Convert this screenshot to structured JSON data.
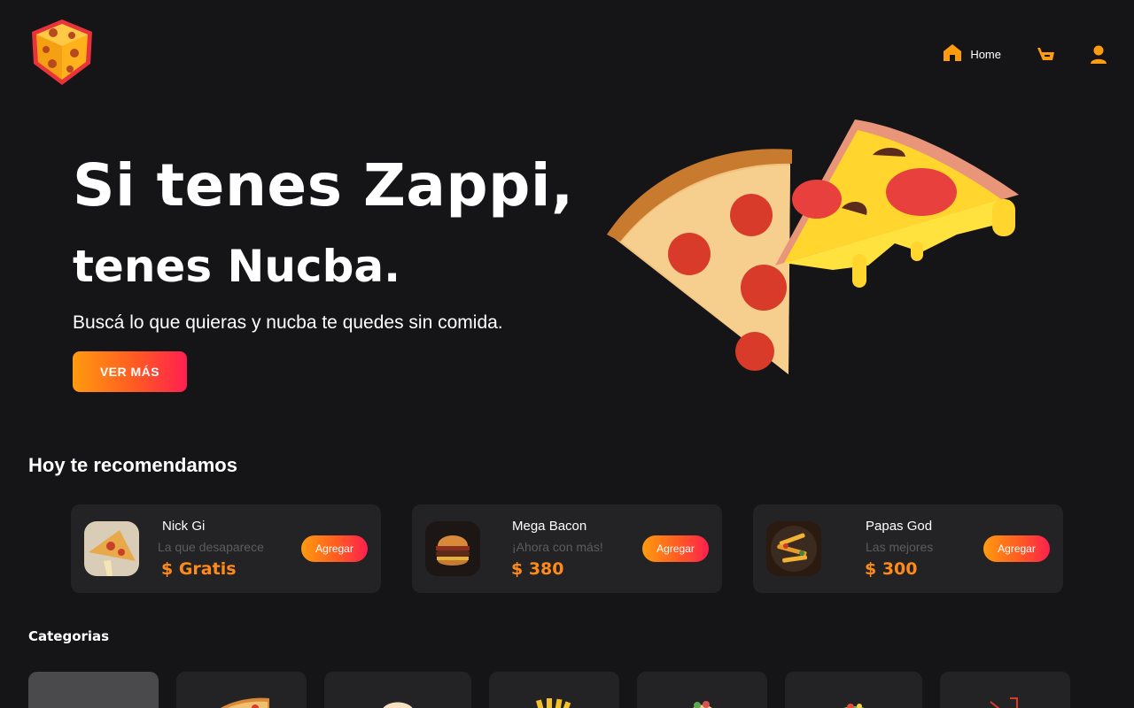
{
  "header": {
    "nav": {
      "home_label": "Home"
    }
  },
  "hero": {
    "title_line1": "Si tenes Zappi,",
    "title_line2": "tenes Nucba.",
    "subtitle": "Buscá lo que quieras y nucba te quedes sin comida.",
    "cta_label": "VER MÁS"
  },
  "recommendations": {
    "title": "Hoy te recomendamos",
    "items": [
      {
        "name": "Nick Gi",
        "description": "La que desaparece",
        "price": "$ Gratis",
        "button": "Agregar"
      },
      {
        "name": "Mega Bacon",
        "description": "¡Ahora con más!",
        "price": "$ 380",
        "button": "Agregar"
      },
      {
        "name": "Papas God",
        "description": "Las mejores",
        "price": "$ 300",
        "button": "Agregar"
      }
    ]
  },
  "categories": {
    "title": "Categorias",
    "items": [
      {
        "icon": "all-icon",
        "active": true
      },
      {
        "icon": "pizza-icon",
        "active": false
      },
      {
        "icon": "burger-icon",
        "active": false
      },
      {
        "icon": "fries-icon",
        "active": false
      },
      {
        "icon": "taco-icon",
        "active": false
      },
      {
        "icon": "salad-icon",
        "active": false
      },
      {
        "icon": "drink-icon",
        "active": false
      }
    ]
  },
  "colors": {
    "background": "#151517",
    "card": "#232325",
    "accent_orange": "#ff9b0f",
    "accent_red": "#ff1f4f",
    "price": "#ff8a1a"
  }
}
